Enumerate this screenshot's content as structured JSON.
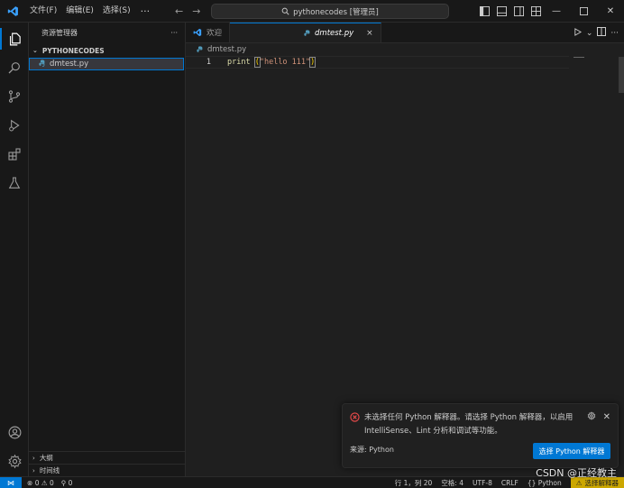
{
  "titlebar": {
    "menu": [
      "文件(F)",
      "编辑(E)",
      "选择(S)"
    ],
    "more": "···",
    "search_text": "pythonecodes [管理员]"
  },
  "sidebar": {
    "title": "资源管理器",
    "more": "···",
    "folder": "PYTHONECODES",
    "file": "dmtest.py",
    "outline": "大纲",
    "timeline": "时间线"
  },
  "editor": {
    "tabs": [
      {
        "label": "欢迎"
      },
      {
        "label": "dmtest.py",
        "close": "×"
      }
    ],
    "breadcrumb": "dmtest.py",
    "line_number": "1",
    "code": {
      "keyword": "print",
      "open": "(",
      "string": "\"hello 111\"",
      "close": ")"
    }
  },
  "notification": {
    "message": "未选择任何 Python 解释器。请选择 Python 解释器，以启用 IntelliSense、Lint 分析和调试等功能。",
    "source": "来源: Python",
    "button": "选择 Python 解释器"
  },
  "statusbar": {
    "errors": "0",
    "warnings": "0",
    "ports": "0",
    "position": "行 1，列 20",
    "spaces": "空格: 4",
    "encoding": "UTF-8",
    "eol": "CRLF",
    "language": "Python",
    "interpreter": "选择解释器"
  },
  "watermark": "CSDN @正经教主",
  "colors": {
    "accent": "#0078d4",
    "warning": "#cca700",
    "error": "#f14c4c"
  }
}
